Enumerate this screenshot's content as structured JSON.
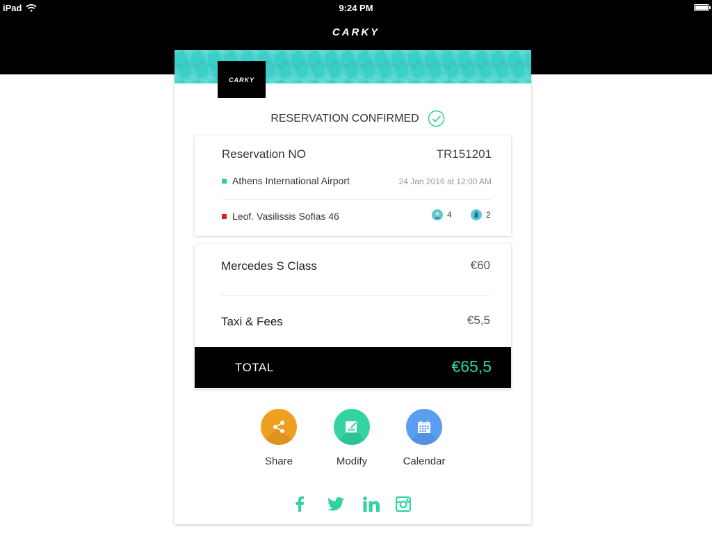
{
  "status_bar": {
    "carrier": "iPad",
    "time": "9:24 PM"
  },
  "header": {
    "logo_text": "CARKY"
  },
  "card": {
    "logo_text": "CARKY",
    "confirmation": "RESERVATION CONFIRMED",
    "reservation": {
      "title": "Reservation NO",
      "number": "TR151201",
      "pickup": {
        "location": "Athens International Airport",
        "datetime": "24 Jan 2016 at 12:00 AM"
      },
      "dropoff": {
        "location": "Leof. Vasilissis Sofias 46"
      },
      "passengers": "4",
      "luggage": "2"
    },
    "pricing": {
      "items": [
        {
          "name": "Mercedes S Class",
          "price": "€60"
        },
        {
          "name": "Taxi & Fees",
          "price": "€5,5"
        }
      ],
      "total_label": "TOTAL",
      "total_value": "€65,5"
    },
    "actions": [
      {
        "label": "Share",
        "icon": "share-icon",
        "color": "#f0a020"
      },
      {
        "label": "Modify",
        "icon": "edit-icon",
        "color": "#35d3a3"
      },
      {
        "label": "Calendar",
        "icon": "calendar-icon",
        "color": "#5a9ef0"
      }
    ],
    "social": [
      "facebook-icon",
      "twitter-icon",
      "linkedin-icon",
      "instagram-icon"
    ]
  },
  "colors": {
    "accent": "#2fd3a0",
    "pattern": "#3ccfc9",
    "pickup_dot": "#2fcf9a",
    "dropoff_dot": "#e02020"
  }
}
